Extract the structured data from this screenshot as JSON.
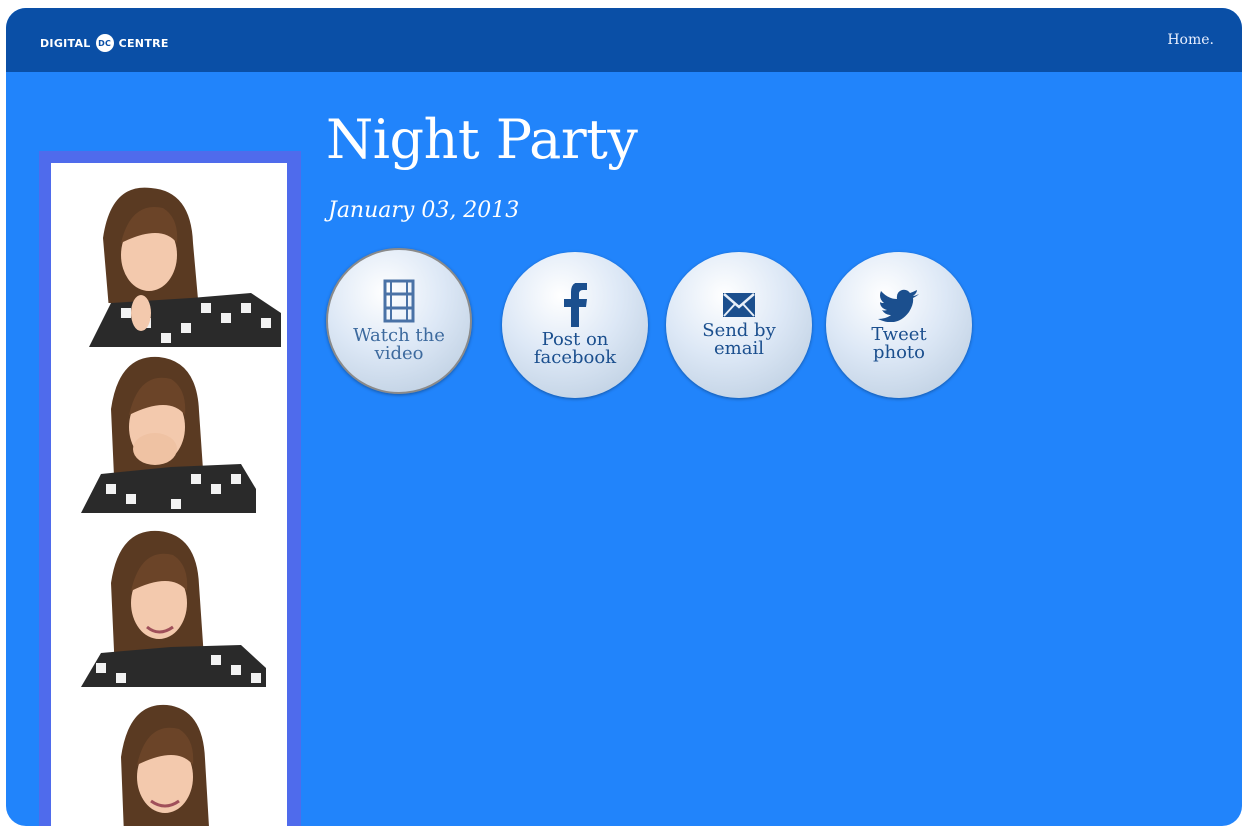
{
  "header": {
    "logo_left": "DIGITAL",
    "logo_badge": "DC",
    "logo_right": "CENTRE",
    "home_link": "Home."
  },
  "event": {
    "title": "Night Party",
    "date": "January 03, 2013"
  },
  "actions": [
    {
      "label": "Watch the\nvideo",
      "icon": "film-icon"
    },
    {
      "label": "Post on\nfacebook",
      "icon": "facebook-icon"
    },
    {
      "label": "Send by\nemail",
      "icon": "envelope-icon"
    },
    {
      "label": "Tweet\nphoto",
      "icon": "twitter-bird-icon"
    }
  ],
  "colors": {
    "background": "#2184fb",
    "topbar": "#0a4fa6",
    "strip_border": "#4f6bec",
    "button_text": "#1b4f8e"
  }
}
